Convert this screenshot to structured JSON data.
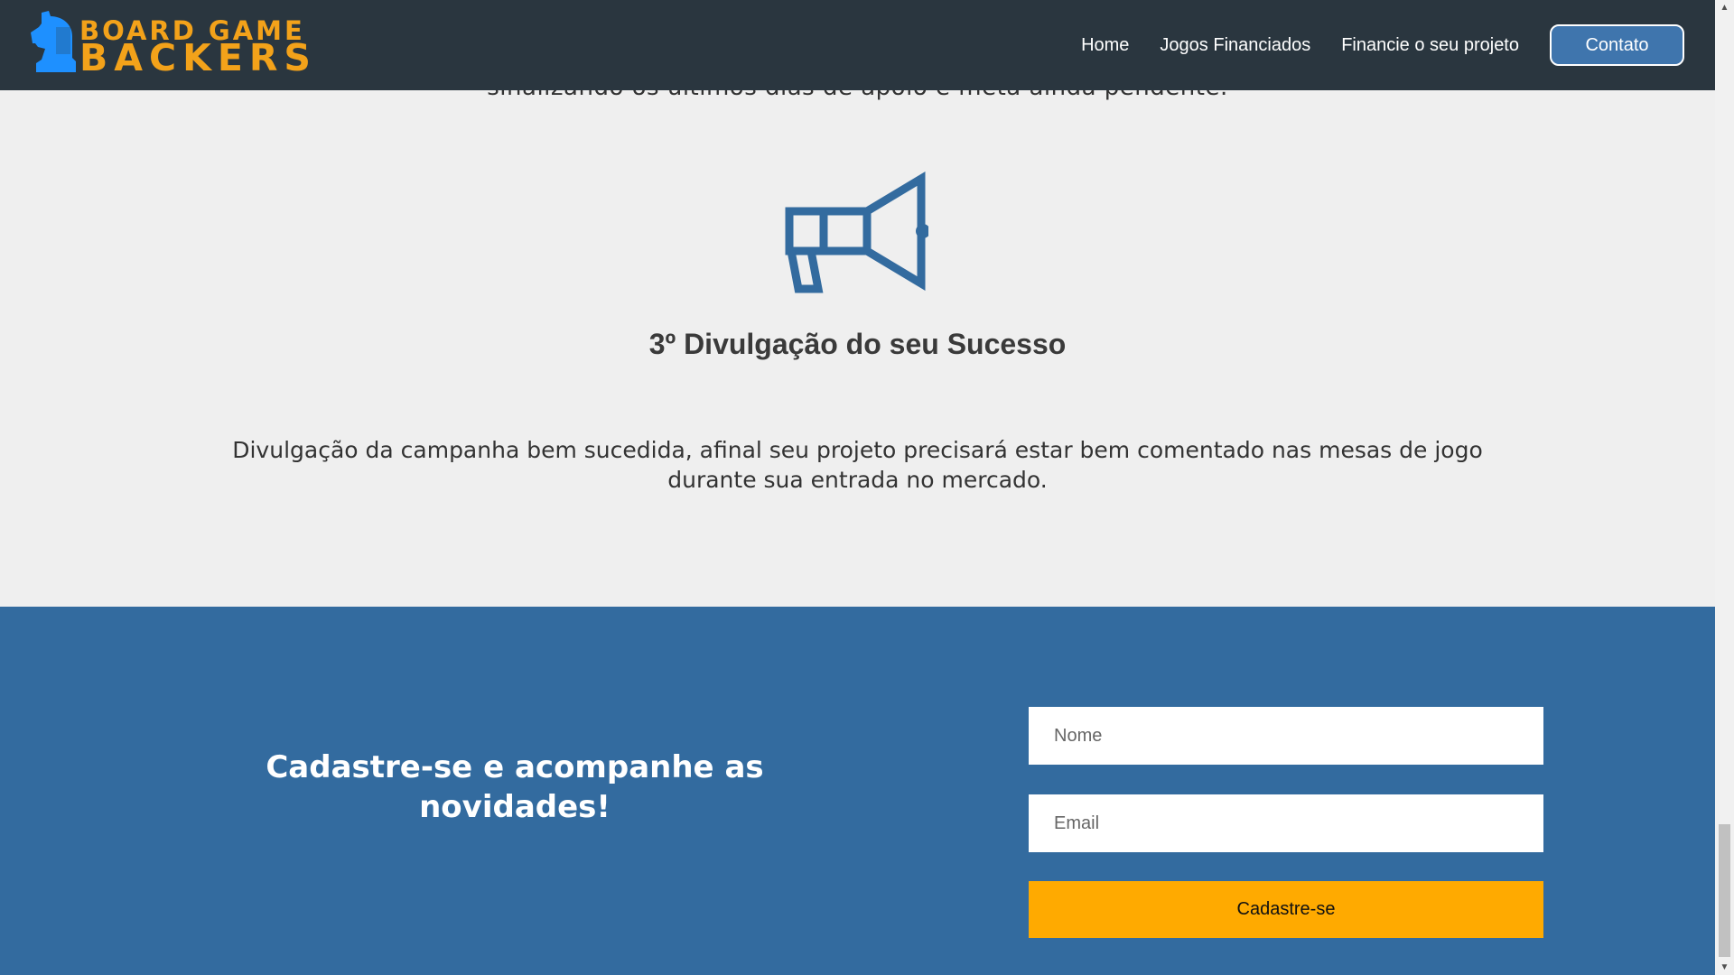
{
  "header": {
    "logo_line1": "BOARD GAME",
    "logo_line2": "BACKERS",
    "logo_icon": "knight-chess-piece-icon",
    "nav": [
      "Home",
      "Jogos Financiados",
      "Financie o seu projeto"
    ],
    "contact_label": "Contato"
  },
  "step": {
    "previous_text_partial": "sinalizando os últimos dias de apoio e meta ainda pendente.",
    "icon": "megaphone-icon",
    "title": "3º Divulgação do seu Sucesso",
    "description": "Divulgação da campanha bem sucedida, afinal seu projeto precisará estar bem comentado nas mesas de jogo durante sua entrada no mercado."
  },
  "signup": {
    "heading": "Cadastre-se e acompanhe as novidades!",
    "name_placeholder": "Nome",
    "email_placeholder": "Email",
    "submit_label": "Cadastre-se"
  },
  "colors": {
    "header_bg": "#2a363f",
    "logo_orange": "#f3a21a",
    "logo_blue": "#1e90ff",
    "accent_blue": "#336b9f",
    "button_yellow": "#ffaa00",
    "page_bg": "#efefef"
  }
}
